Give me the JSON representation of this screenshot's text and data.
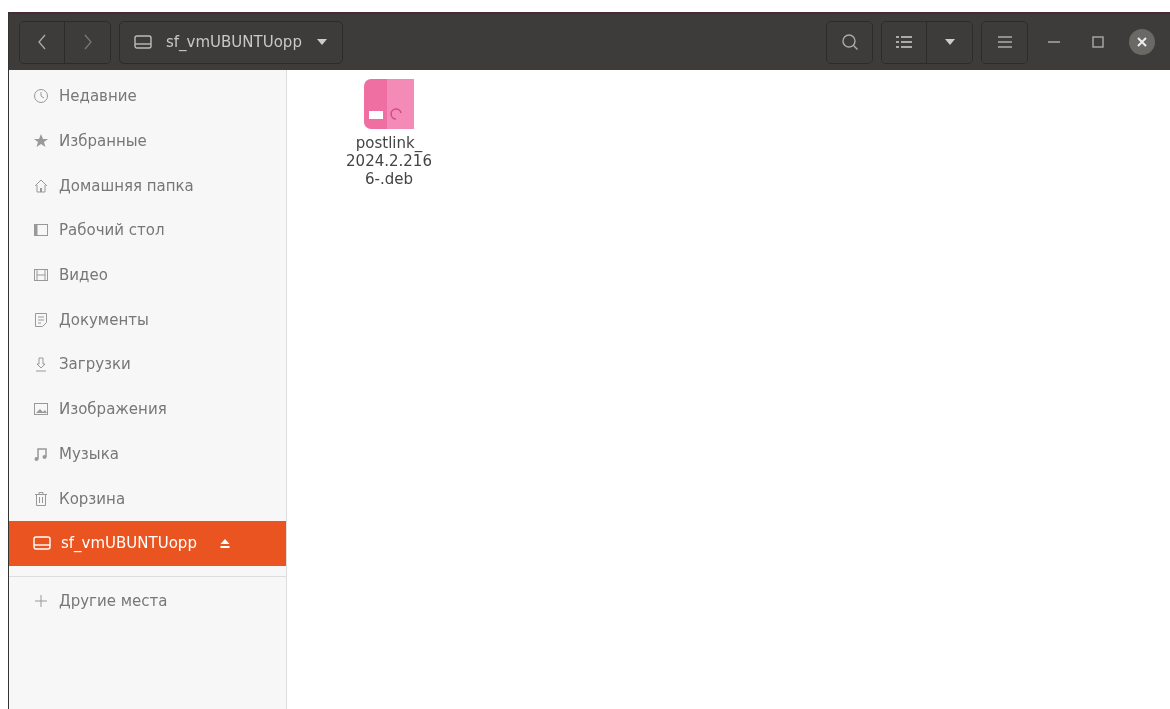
{
  "header": {
    "location": "sf_vmUBUNTUopp"
  },
  "sidebar": {
    "items": [
      {
        "label": "Недавние",
        "selected": false,
        "ejectable": false
      },
      {
        "label": "Избранные",
        "selected": false,
        "ejectable": false
      },
      {
        "label": "Домашняя папка",
        "selected": false,
        "ejectable": false
      },
      {
        "label": "Рабочий стол",
        "selected": false,
        "ejectable": false
      },
      {
        "label": "Видео",
        "selected": false,
        "ejectable": false
      },
      {
        "label": "Документы",
        "selected": false,
        "ejectable": false
      },
      {
        "label": "Загрузки",
        "selected": false,
        "ejectable": false
      },
      {
        "label": "Изображения",
        "selected": false,
        "ejectable": false
      },
      {
        "label": "Музыка",
        "selected": false,
        "ejectable": false
      },
      {
        "label": "Корзина",
        "selected": false,
        "ejectable": false
      },
      {
        "label": "sf_vmUBUNTUopp",
        "selected": true,
        "ejectable": true
      }
    ],
    "other_places": "Другие места"
  },
  "files": [
    {
      "name_lines": [
        "postlink_",
        "2024.2.216",
        "6-.deb"
      ],
      "selected": false
    }
  ]
}
